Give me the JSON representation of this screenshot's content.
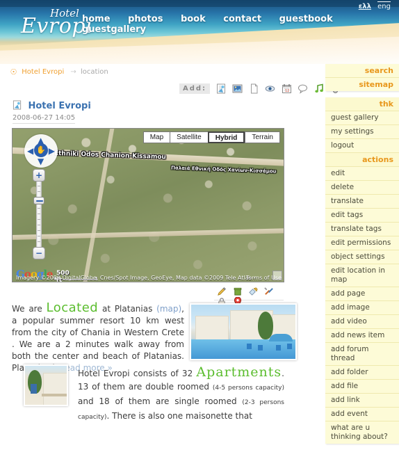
{
  "header": {
    "logo_small": "Hotel",
    "logo_big": "Evropi",
    "nav": [
      {
        "label": "home"
      },
      {
        "label": "photos"
      },
      {
        "label": "book"
      },
      {
        "label": "contact"
      },
      {
        "label": "guestbook"
      },
      {
        "label": "guestgallery"
      }
    ],
    "lang": {
      "ell": "ελλ",
      "eng": "eng"
    }
  },
  "breadcrumb": {
    "icon": "at-icon",
    "root": "Hotel Evropi",
    "separator": "→",
    "current": "location"
  },
  "addbar": {
    "label": "Add:",
    "icons": [
      {
        "name": "add-page-icon"
      },
      {
        "name": "add-image-icon"
      },
      {
        "name": "add-file-icon"
      },
      {
        "name": "add-link-icon"
      },
      {
        "name": "add-event-icon"
      },
      {
        "name": "add-comment-icon"
      },
      {
        "name": "add-music-icon"
      },
      {
        "name": "add-video-icon"
      }
    ]
  },
  "object": {
    "icon": "page-icon",
    "title": "Hotel Evropi",
    "date": "2008-06-27 14:05"
  },
  "map": {
    "types": [
      {
        "label": "Map",
        "active": false
      },
      {
        "label": "Satellite",
        "active": false
      },
      {
        "label": "Hybrid",
        "active": true
      },
      {
        "label": "Terrain",
        "active": false
      }
    ],
    "road_label_main": "Palaia Ethniki Odos Chanion-Kissamou",
    "road_label_secondary": "Παλαιά Εθνική Οδός Χανίων-Κισσάμου",
    "scale_label": "500 ft",
    "attribution": "Imagery ©2009 DigitalGlobe, Cnes/Spot Image, GeoEye, Map data ©2009 Tele Atlas -",
    "terms": "Terms of Use",
    "google_logo": {
      "g1": "G",
      "o1": "o",
      "o2": "o",
      "g2": "g",
      "l": "l",
      "e": "e"
    },
    "zoom_in": "+",
    "zoom_out": "−",
    "pan_up": "▲",
    "pan_down": "▼",
    "pan_left": "◀",
    "pan_right": "▶",
    "pan_center": "✋"
  },
  "article1": {
    "tools": [
      {
        "name": "edit-icon"
      },
      {
        "name": "delete-icon"
      },
      {
        "name": "tags-icon"
      },
      {
        "name": "settings-icon"
      },
      {
        "name": "permissions-lock-icon"
      },
      {
        "name": "location-pin-icon"
      }
    ],
    "text_before": "We are ",
    "highlight": "Located",
    "text_mid1": " at Platanias ",
    "map_link": "(map)",
    "text_mid2": ", a popular summer resort 10 km west from the city of Chania in Western Crete . We are a 2 minutes walk away from both the center and beach of Platanias. Platanias is ",
    "read_more": "read more »",
    "photo_alt": "hotel-pool-photo"
  },
  "article2": {
    "thumb_alt": "apartment-building-thumbnail",
    "text_before": "Hotel Evropi consists of 32 ",
    "highlight": "Apartments",
    "text_mid1": ". 13 of them are double roomed ",
    "small1": "(4-5 persons capacity)",
    "text_mid2": " and 18 of them are single roomed ",
    "small2": "(2-3 persons capacity)",
    "text_end": ". There is also one maisonette that"
  },
  "sidebar": {
    "panel_top": [
      {
        "label": "search"
      },
      {
        "label": "sitemap"
      }
    ],
    "user_header": "thk",
    "user_items": [
      {
        "label": "guest gallery"
      },
      {
        "label": "my settings"
      },
      {
        "label": "logout"
      }
    ],
    "actions_header": "actions",
    "actions": [
      {
        "label": "edit"
      },
      {
        "label": "delete"
      },
      {
        "label": "translate"
      },
      {
        "label": "edit tags"
      },
      {
        "label": "translate tags"
      },
      {
        "label": "edit permissions"
      },
      {
        "label": "object settings"
      },
      {
        "label": "edit location in map"
      },
      {
        "label": "add page"
      },
      {
        "label": "add image"
      },
      {
        "label": "add video"
      },
      {
        "label": "add news item"
      },
      {
        "label": "add forum thread"
      },
      {
        "label": "add folder"
      },
      {
        "label": "add file"
      },
      {
        "label": "add link"
      },
      {
        "label": "add event"
      },
      {
        "label": "what are u thinking about?"
      }
    ]
  },
  "colors": {
    "accent_orange": "#e8971c",
    "link_blue": "#3b72b0",
    "highlight_green": "#5bbd2e",
    "panel_bg": "#fdfbd7",
    "sea_deep": "#1a4f7a",
    "sea_light": "#6cc6d6",
    "sand": "#f4e3b6"
  }
}
